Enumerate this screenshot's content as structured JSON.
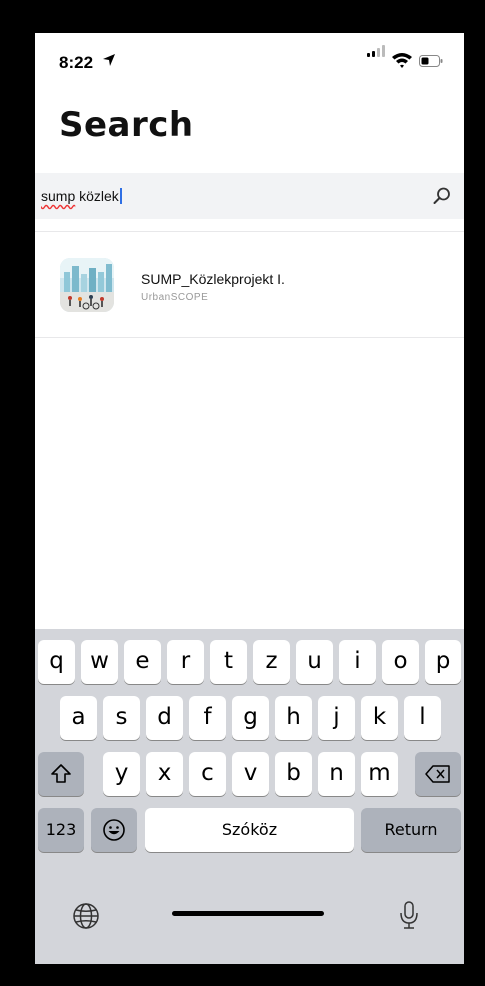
{
  "status_bar": {
    "time": "8:22"
  },
  "page": {
    "title": "Search"
  },
  "search": {
    "typed_underlined": "sump",
    "typed_rest": " közlek"
  },
  "results": [
    {
      "title": "SUMP_Közlekprojekt I.",
      "subtitle": "UrbanSCOPE"
    }
  ],
  "keyboard": {
    "row1": [
      "q",
      "w",
      "e",
      "r",
      "t",
      "z",
      "u",
      "i",
      "o",
      "p"
    ],
    "row2": [
      "a",
      "s",
      "d",
      "f",
      "g",
      "h",
      "j",
      "k",
      "l"
    ],
    "row3": [
      "y",
      "x",
      "c",
      "v",
      "b",
      "n",
      "m"
    ],
    "numbers_label": "123",
    "space_label": "Szóköz",
    "return_label": "Return"
  },
  "icons": [
    "location-arrow-icon",
    "signal-icon",
    "wifi-icon",
    "battery-icon",
    "search-icon",
    "shift-icon",
    "backspace-icon",
    "emoji-icon",
    "globe-icon",
    "microphone-icon"
  ]
}
